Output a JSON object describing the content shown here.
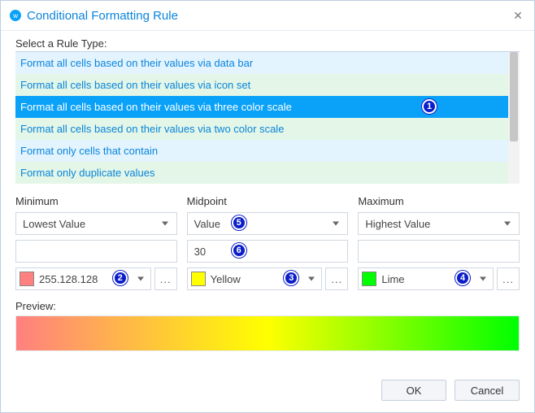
{
  "title": "Conditional Formatting Rule",
  "rule_type_label": "Select a Rule Type:",
  "rule_items": [
    "Format all cells based on their values via data bar",
    "Format all cells based on their values via icon set",
    "Format all cells based on their values via three color scale",
    "Format all cells based on their values via two color scale",
    "Format only cells that contain",
    "Format only duplicate values"
  ],
  "selected_index": 2,
  "columns": {
    "min": {
      "label": "Minimum",
      "type": "Lowest Value",
      "value": "",
      "color_name": "255.128.128",
      "color_hex": "#ff8080"
    },
    "mid": {
      "label": "Midpoint",
      "type": "Value",
      "value": "30",
      "color_name": "Yellow",
      "color_hex": "#ffff00"
    },
    "max": {
      "label": "Maximum",
      "type": "Highest Value",
      "value": "",
      "color_name": "Lime",
      "color_hex": "#00ff00"
    }
  },
  "preview_label": "Preview:",
  "buttons": {
    "ok": "OK",
    "cancel": "Cancel"
  },
  "more_btn": "...",
  "callouts": {
    "c1": "1",
    "c2": "2",
    "c3": "3",
    "c4": "4",
    "c5": "5",
    "c6": "6"
  }
}
